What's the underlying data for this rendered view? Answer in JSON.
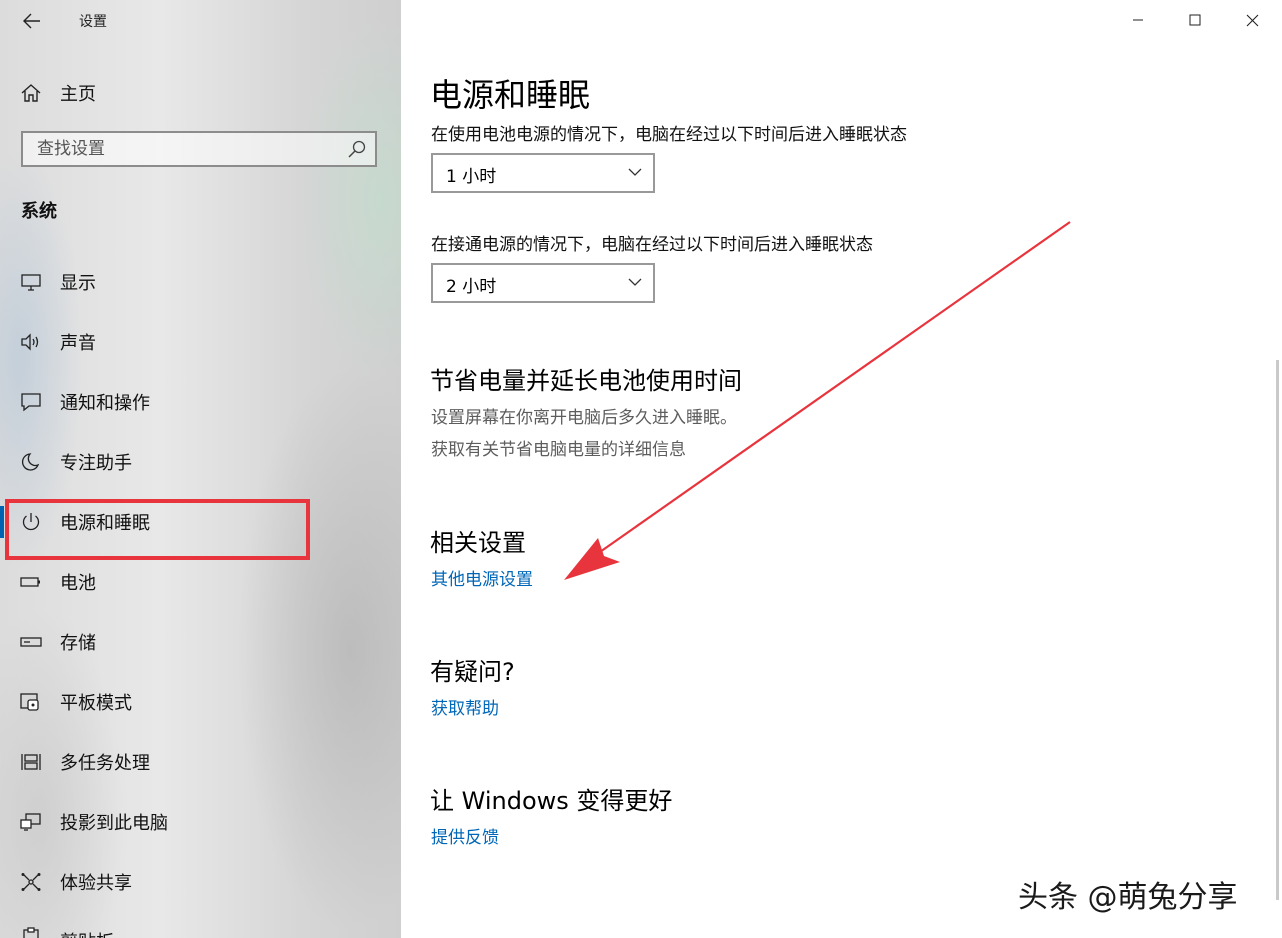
{
  "window": {
    "app_title": "设置",
    "back_icon": "back-arrow-icon",
    "controls": [
      "minimize-icon",
      "maximize-icon",
      "close-icon"
    ]
  },
  "sidebar": {
    "home_label": "主页",
    "search_placeholder": "查找设置",
    "section_title": "系统",
    "items": [
      {
        "label": "显示",
        "icon": "monitor-icon"
      },
      {
        "label": "声音",
        "icon": "speaker-icon"
      },
      {
        "label": "通知和操作",
        "icon": "notification-icon"
      },
      {
        "label": "专注助手",
        "icon": "moon-icon"
      },
      {
        "label": "电源和睡眠",
        "icon": "power-icon",
        "active": true
      },
      {
        "label": "电池",
        "icon": "battery-icon"
      },
      {
        "label": "存储",
        "icon": "storage-icon"
      },
      {
        "label": "平板模式",
        "icon": "tablet-mode-icon"
      },
      {
        "label": "多任务处理",
        "icon": "multitasking-icon"
      },
      {
        "label": "投影到此电脑",
        "icon": "project-icon"
      },
      {
        "label": "体验共享",
        "icon": "shared-experience-icon"
      },
      {
        "label": "剪贴板",
        "icon": "clipboard-icon"
      }
    ]
  },
  "main": {
    "page_title": "电源和睡眠",
    "battery_sleep_desc": "在使用电池电源的情况下，电脑在经过以下时间后进入睡眠状态",
    "battery_sleep_value": "1 小时",
    "plugged_sleep_desc": "在接通电源的情况下，电脑在经过以下时间后进入睡眠状态",
    "plugged_sleep_value": "2 小时",
    "save_power": {
      "title": "节省电量并延长电池使用时间",
      "line1": "设置屏幕在你离开电脑后多久进入睡眠。",
      "line2": "获取有关节省电脑电量的详细信息"
    },
    "related": {
      "title": "相关设置",
      "link": "其他电源设置"
    },
    "help": {
      "title": "有疑问?",
      "link": "获取帮助"
    },
    "feedback": {
      "title": "让 Windows 变得更好",
      "link": "提供反馈"
    }
  },
  "watermark": "头条 @萌兔分享",
  "colors": {
    "accent": "#0063b1",
    "link": "#0067b8",
    "annotation_red": "#e8343c"
  }
}
